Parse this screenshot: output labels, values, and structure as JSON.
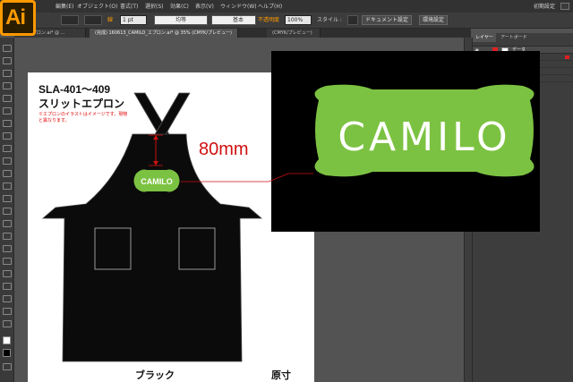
{
  "app": {
    "logo_text": "Ai"
  },
  "menu": {
    "items": [
      "編集(E)",
      "オブジェクト(O)",
      "書式(T)",
      "選択(S)",
      "効果(C)",
      "表示(V)",
      "ウィンドウ(W)",
      "ヘルプ(H)"
    ],
    "workspace_label": "初期設定"
  },
  "controlbar": {
    "stroke_label": "線",
    "stroke_weight": "1 pt",
    "uniform_label": "均等",
    "basic_label": "基本",
    "opacity_label": "不透明度",
    "opacity_value": "100%",
    "style_label": "スタイル :",
    "doc_setup_button": "ドキュメント設定",
    "prefs_button": "環境設定"
  },
  "tabs": [
    {
      "label": "50_エプロン.ai* @ ...",
      "active": false
    },
    {
      "label": "(完成) 160613_CAMILO_エプロン.ai* @ 35% (CMYK/プレビュー)",
      "active": true
    },
    {
      "label": "(CMYK/プレビュー)",
      "active": false
    }
  ],
  "artboard": {
    "product_code": "SLA-401〜409",
    "product_name": "スリットエプロン",
    "note": "※エプロンのイラストはイメージです。現物と異なります。",
    "color_label": "ブラック",
    "scale_label": "原寸",
    "apron_logo_text": "CAMILO"
  },
  "measurement": {
    "label": "80mm",
    "color": "#d01010"
  },
  "zoom": {
    "logo_text": "CAMILO",
    "logo_color": "#7cc242",
    "background": "#000000"
  },
  "panels": {
    "tabs": [
      "レイヤー",
      "アートボード"
    ],
    "layer_name": "データ",
    "layer_color": "#e02020"
  },
  "colors": {
    "accent": "#ff9a00",
    "logo_green": "#7cc242",
    "measure_red": "#d01010"
  }
}
